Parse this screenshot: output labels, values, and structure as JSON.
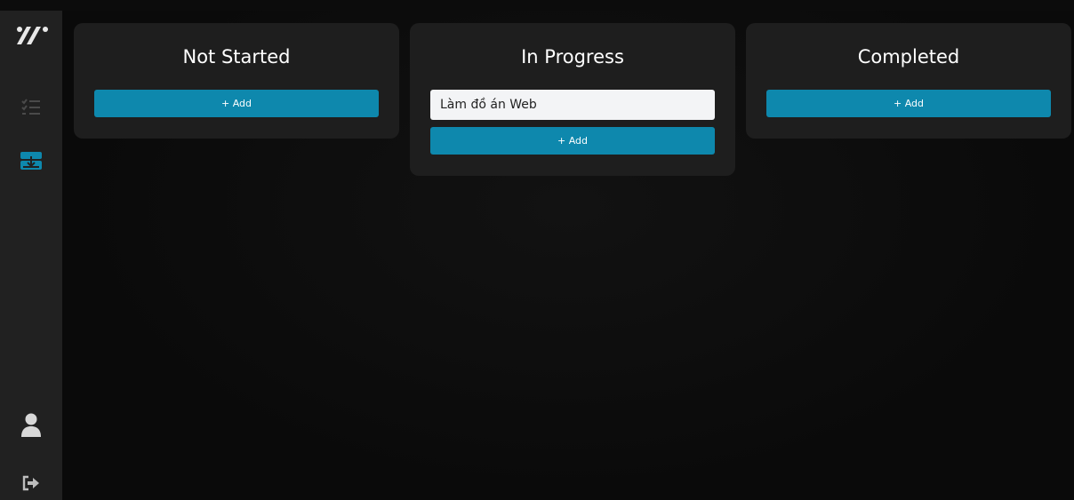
{
  "columns": [
    {
      "title": "Not Started",
      "tasks": [],
      "add_label": "+ Add"
    },
    {
      "title": "In Progress",
      "tasks": [
        "Làm đồ án Web"
      ],
      "add_label": "+ Add"
    },
    {
      "title": "Completed",
      "tasks": [],
      "add_label": "+ Add"
    }
  ],
  "sidebar": {
    "items": [
      {
        "icon": "app-logo-icon"
      },
      {
        "icon": "checklist-icon"
      },
      {
        "icon": "board-icon"
      },
      {
        "icon": "user-icon"
      },
      {
        "icon": "logout-icon"
      }
    ]
  },
  "colors": {
    "accent": "#0e88ad",
    "sidebar_bg": "#212121",
    "column_bg": "#1e1e1e",
    "page_bg": "#0c0c0c",
    "card_bg": "#f3f4f6"
  }
}
